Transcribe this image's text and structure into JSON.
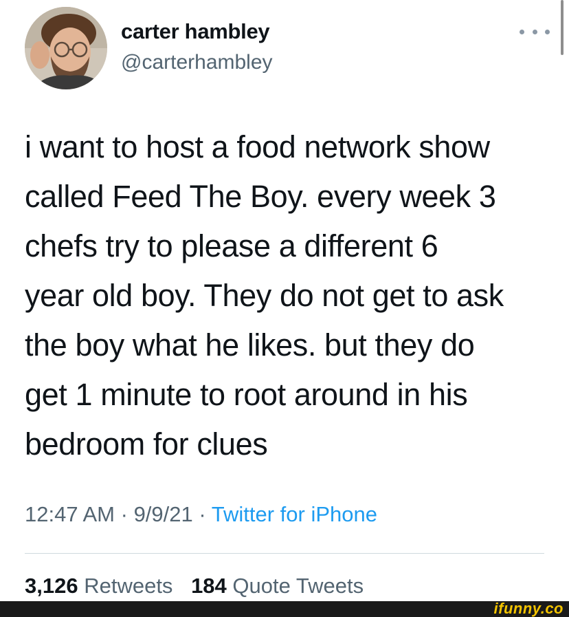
{
  "tweet": {
    "author_name": "carter hambley",
    "author_handle": "@carterhambley",
    "text": "i want to host a food network show\ncalled Feed The Boy. every week 3\nchefs try to please a different 6\nyear old boy. They do not get to ask\nthe boy what he likes. but they do\nget 1 minute to root around in his\nbedroom for clues",
    "time": "12:47 AM",
    "date": "9/9/21",
    "separator": "·",
    "source": "Twitter for iPhone",
    "retweets_count": "3,126",
    "retweets_label": "Retweets",
    "quotes_count": "184",
    "quotes_label": "Quote Tweets"
  },
  "icons": {
    "more": "more-horizontal-icon"
  },
  "colors": {
    "text_primary": "#0f1419",
    "text_secondary": "#536471",
    "link": "#1d9bf0",
    "divider": "#cfd9de",
    "watermark": "#f3c300"
  },
  "watermark": "ifunny.co"
}
